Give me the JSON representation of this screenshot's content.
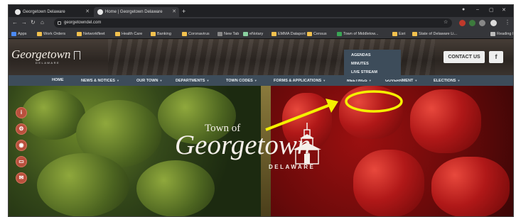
{
  "browser": {
    "tabs": [
      {
        "title": "Georgetown Delaware"
      },
      {
        "title": "Home | Georgetown Delaware"
      }
    ],
    "new_tab": "+",
    "url": "georgetowndel.com",
    "bookmarks": [
      {
        "label": "Apps",
        "color": "#4c8bf5"
      },
      {
        "label": "Work Orders",
        "color": "#f2c14e"
      },
      {
        "label": "Networkfleet",
        "color": "#f2c14e"
      },
      {
        "label": "Health Care",
        "color": "#f2c14e"
      },
      {
        "label": "Banking",
        "color": "#f2c14e"
      },
      {
        "label": "Coronavirus",
        "color": "#f2c14e"
      },
      {
        "label": "New Tab",
        "color": "#888888"
      },
      {
        "label": "eNotary",
        "color": "#8ad0a0"
      },
      {
        "label": "EMMA Dataport",
        "color": "#f2c14e"
      },
      {
        "label": "Census",
        "color": "#f2c14e"
      },
      {
        "label": "Town of Middletow...",
        "color": "#3aa655"
      },
      {
        "label": "Esri",
        "color": "#f2c14e"
      },
      {
        "label": "State of Delaware Li...",
        "color": "#f2c14e"
      },
      {
        "label": "Reading list",
        "color": "#bbbbbb"
      }
    ]
  },
  "site": {
    "logo_text": "Georgetown",
    "logo_subtext": "DELAWARE",
    "contact_button": "CONTACT US",
    "facebook_label": "f",
    "menu": [
      {
        "label": "HOME"
      },
      {
        "label": "NEWS & NOTICES"
      },
      {
        "label": "OUR TOWN"
      },
      {
        "label": "DEPARTMENTS"
      },
      {
        "label": "TOWN CODES"
      },
      {
        "label": "FORMS & APPLICATIONS"
      },
      {
        "label": "MEETINGS"
      },
      {
        "label": "GOVERNMENT"
      },
      {
        "label": "ELECTIONS"
      }
    ],
    "meetings_dropdown": [
      {
        "label": "AGENDAS"
      },
      {
        "label": "MINUTES"
      },
      {
        "label": "LIVE STREAM"
      }
    ],
    "hero": {
      "town_of": "Town of",
      "name": "Georgetown",
      "state": "DELAWARE"
    },
    "side_icons": [
      "info-icon",
      "gear-icon",
      "eye-icon",
      "card-icon",
      "mail-icon"
    ]
  },
  "annotation": {
    "color": "#f5f000",
    "target": "LIVE STREAM"
  }
}
